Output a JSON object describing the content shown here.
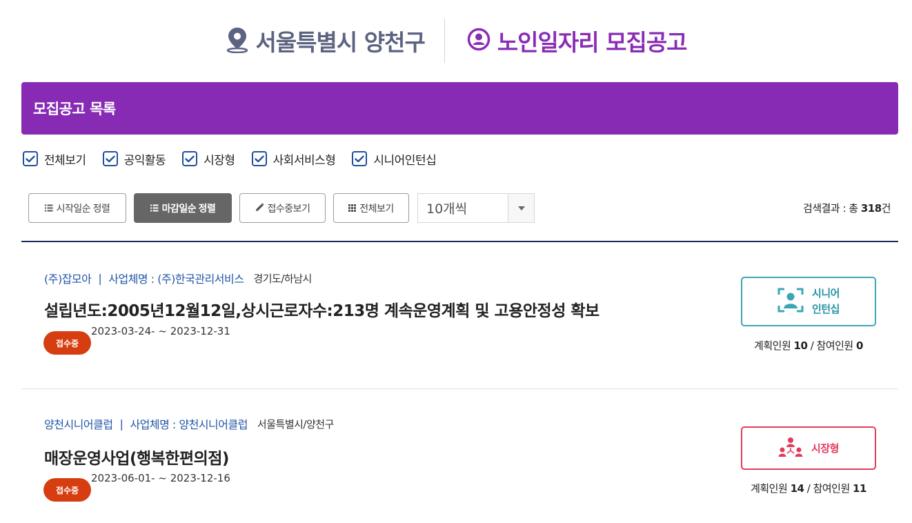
{
  "header": {
    "region": "서울특별시 양천구",
    "title": "노인일자리 모집공고"
  },
  "banner": {
    "title": "모집공고 목록"
  },
  "filters": [
    {
      "label": "전체보기",
      "checked": true
    },
    {
      "label": "공익활동",
      "checked": true
    },
    {
      "label": "시장형",
      "checked": true
    },
    {
      "label": "사회서비스형",
      "checked": true
    },
    {
      "label": "시니어인턴십",
      "checked": true
    }
  ],
  "toolbar": {
    "sort_start": "시작일순 정렬",
    "sort_end": "마감일순 정렬",
    "accepting": "접수중보기",
    "view_all": "전체보기",
    "page_size": "10개씩"
  },
  "result": {
    "prefix": "검색결과 : 총 ",
    "count": "318",
    "suffix": "건"
  },
  "colors": {
    "brand_purple": "#872bb4",
    "badge_red": "#d63d10",
    "senior_teal": "#3ba7b3",
    "market_red": "#e23a5d",
    "link_blue": "#1f55a8"
  },
  "items": [
    {
      "org": "(주)잡모아",
      "sep": "|",
      "biz": "사업체명 : (주)한국관리서비스",
      "location": "경기도/하남시",
      "title": "설립년도:2005년12월12일,상시근로자수:213명 계속운영계획 및 고용안정성 확보",
      "status": "접수중",
      "dates": "2023-03-24- ~ 2023-12-31",
      "type_line1": "시니어",
      "type_line2": "인턴십",
      "type_icon": "senior-intern-icon",
      "planned_label": "계획인원",
      "planned": "10",
      "slash": "/",
      "joined_label": "참여인원",
      "joined": "0"
    },
    {
      "org": "양천시니어클럽",
      "sep": "|",
      "biz": "사업체명 : 양천시니어클럽",
      "location": "서울특별시/양천구",
      "title": "매장운영사업(행복한편의점)",
      "status": "접수중",
      "dates": "2023-06-01- ~ 2023-12-16",
      "type_label": "시장형",
      "type_icon": "market-type-icon",
      "planned_label": "계획인원",
      "planned": "14",
      "slash": "/",
      "joined_label": "참여인원",
      "joined": "11"
    }
  ]
}
